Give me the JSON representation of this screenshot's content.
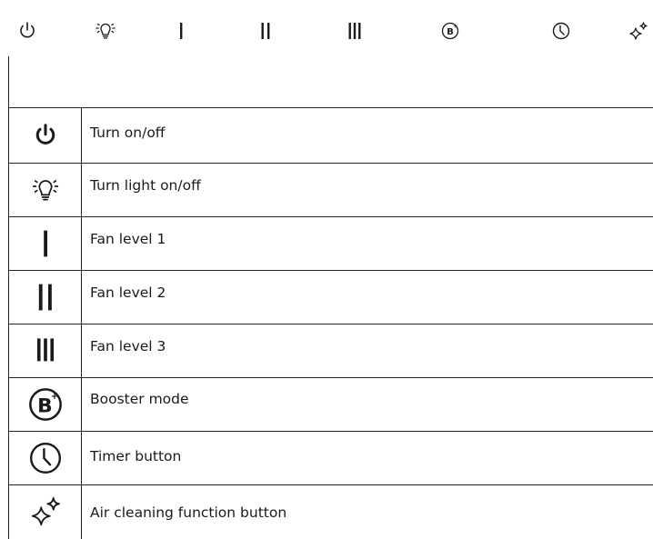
{
  "strip_icons": [
    {
      "icon": "power-icon"
    },
    {
      "icon": "light-bulb-icon"
    },
    {
      "icon": "fan-level-1-icon"
    },
    {
      "icon": "fan-level-2-icon"
    },
    {
      "icon": "fan-level-3-icon"
    },
    {
      "icon": "booster-icon"
    },
    {
      "icon": "timer-icon"
    },
    {
      "icon": "sparkle-icon"
    }
  ],
  "rows": [
    {
      "icon": "power-icon",
      "label": "Turn on/off"
    },
    {
      "icon": "light-bulb-icon",
      "label": "Turn light on/off"
    },
    {
      "icon": "fan-level-1-icon",
      "label": "Fan level 1"
    },
    {
      "icon": "fan-level-2-icon",
      "label": "Fan level 2"
    },
    {
      "icon": "fan-level-3-icon",
      "label": "Fan level 3"
    },
    {
      "icon": "booster-icon",
      "label": "Booster mode"
    },
    {
      "icon": "timer-icon",
      "label": "Timer button"
    },
    {
      "icon": "sparkle-icon",
      "label": "Air cleaning function button"
    }
  ]
}
